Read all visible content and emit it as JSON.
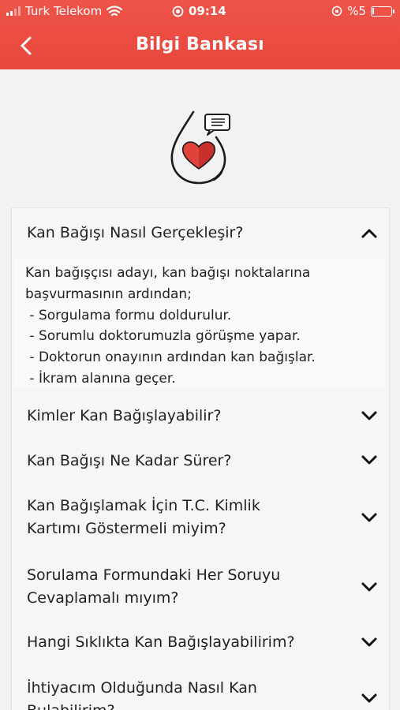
{
  "status_bar": {
    "carrier": "Turk Telekom",
    "time": "09:14",
    "battery": "%5"
  },
  "header": {
    "title": "Bilgi Bankası"
  },
  "faq": [
    {
      "question": "Kan Bağışı Nasıl Gerçekleşir?",
      "expanded": true,
      "answer": [
        "Kan bağışçısı adayı, kan bağışı noktalarına",
        "başvurmasının ardından;",
        " - Sorgulama formu doldurulur.",
        " - Sorumlu doktorumuzla görüşme yapar.",
        " - Doktorun onayının ardından kan bağışlar.",
        " - İkram alanına geçer."
      ]
    },
    {
      "question_lines": [
        "Kimler Kan Bağışlayabilir?"
      ],
      "expanded": false
    },
    {
      "question_lines": [
        "Kan Bağışı Ne Kadar Sürer?"
      ],
      "expanded": false
    },
    {
      "question_lines": [
        "Kan Bağışlamak İçin T.C. Kimlik",
        "Kartımı Göstermeli miyim?"
      ],
      "expanded": false
    },
    {
      "question_lines": [
        "Sorulama Formundaki Her Soruyu",
        "Cevaplamalı mıyım?"
      ],
      "expanded": false
    },
    {
      "question_lines": [
        "Hangi Sıklıkta Kan Bağışlayabilirim?"
      ],
      "expanded": false
    },
    {
      "question_lines": [
        "İhtiyacım Olduğunda Nasıl Kan",
        "Bulabilirim?"
      ],
      "expanded": false
    }
  ],
  "colors": {
    "header": "#ea4b40",
    "heart": "#e0433a",
    "background": "#f2f2f2"
  },
  "icons": [
    "signal-icon",
    "wifi-icon",
    "alarm-icon",
    "rotation-lock-icon",
    "battery-icon",
    "back-arrow-icon",
    "blood-drop-heart-icon",
    "chevron-up-icon",
    "chevron-down-icon"
  ]
}
